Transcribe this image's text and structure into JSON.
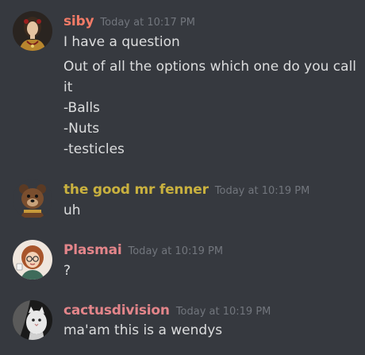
{
  "messages": [
    {
      "author": "siby",
      "author_color": "#f47b67",
      "timestamp": "Today at 10:17 PM",
      "lines": [
        "I have a question",
        "Out of all the options which one do you call",
        "it",
        "-Balls",
        "-Nuts",
        "-testicles"
      ]
    },
    {
      "author": "the good mr fenner",
      "author_color": "#c9b13f",
      "timestamp": "Today at 10:19 PM",
      "lines": [
        "uh"
      ]
    },
    {
      "author": "Plasmai",
      "author_color": "#e3858a",
      "timestamp": "Today at 10:19 PM",
      "lines": [
        "?"
      ]
    },
    {
      "author": "cactusdivision",
      "author_color": "#e3858a",
      "timestamp": "Today at 10:19 PM",
      "lines": [
        "ma'am this is a wendys"
      ]
    }
  ]
}
